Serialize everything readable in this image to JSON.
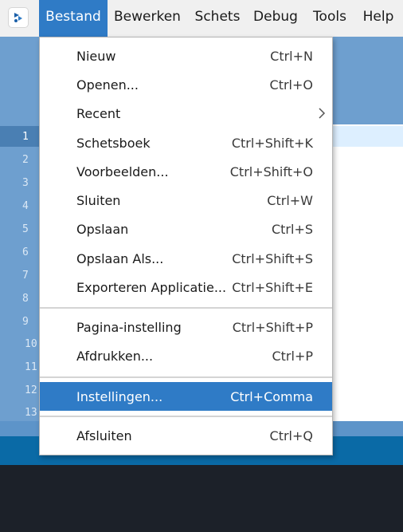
{
  "menubar": {
    "items": [
      {
        "label": "Bestand",
        "active": true
      },
      {
        "label": "Bewerken"
      },
      {
        "label": "Schets"
      },
      {
        "label": "Debug"
      },
      {
        "label": "Tools"
      },
      {
        "label": "Help"
      }
    ]
  },
  "editor": {
    "line_numbers": [
      "1",
      "2",
      "3",
      "4",
      "5",
      "6",
      "7",
      "8",
      "9",
      "10",
      "11",
      "12",
      "13"
    ]
  },
  "file_menu": {
    "items": [
      {
        "label": "Nieuw",
        "shortcut": "Ctrl+N"
      },
      {
        "label": "Openen...",
        "shortcut": "Ctrl+O"
      },
      {
        "label": "Recent",
        "shortcut": "",
        "submenu": true
      },
      {
        "label": "Schetsboek",
        "shortcut": "Ctrl+Shift+K"
      },
      {
        "label": "Voorbeelden...",
        "shortcut": "Ctrl+Shift+O"
      },
      {
        "label": "Sluiten",
        "shortcut": "Ctrl+W"
      },
      {
        "label": "Opslaan",
        "shortcut": "Ctrl+S"
      },
      {
        "label": "Opslaan Als...",
        "shortcut": "Ctrl+Shift+S"
      },
      {
        "label": "Exporteren Applicatie...",
        "shortcut": "Ctrl+Shift+E"
      },
      {
        "label": "Pagina-instelling",
        "shortcut": "Ctrl+Shift+P"
      },
      {
        "label": "Afdrukken...",
        "shortcut": "Ctrl+P"
      },
      {
        "label": "Instellingen...",
        "shortcut": "Ctrl+Comma",
        "highlighted": true
      },
      {
        "label": "Afsluiten",
        "shortcut": "Ctrl+Q"
      }
    ]
  },
  "colors": {
    "accent": "#2f7bc6",
    "menubar_bg": "#f0f0f0",
    "editor_chrome": "#6e9fcf",
    "console_bg": "#1c2129"
  }
}
